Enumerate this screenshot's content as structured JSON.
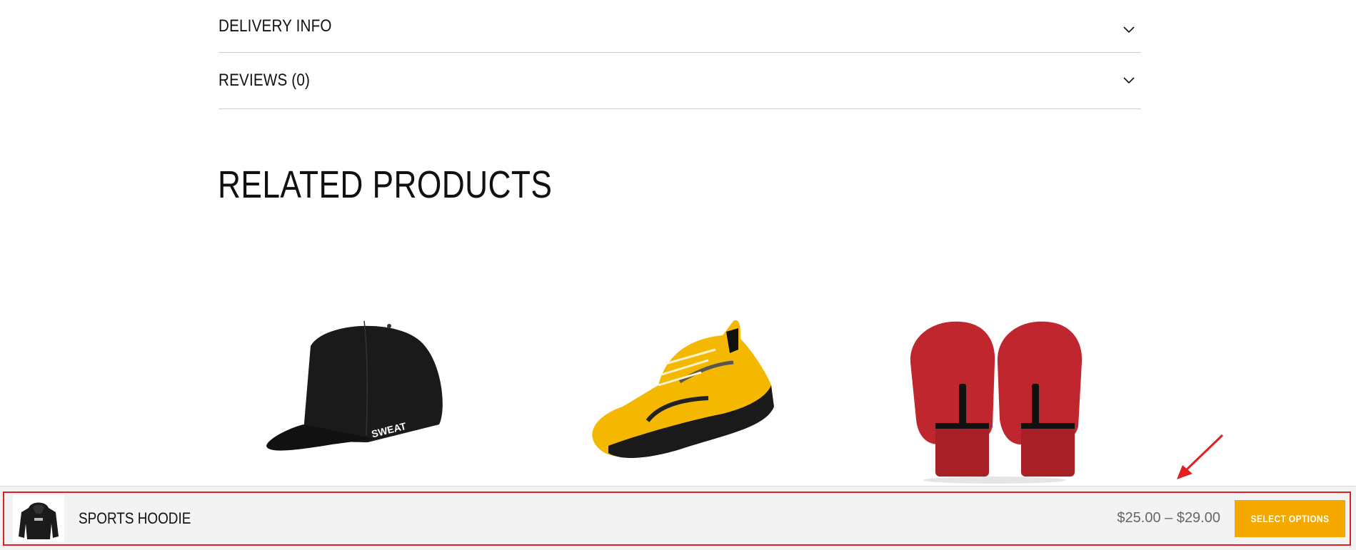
{
  "accordion": {
    "items": [
      {
        "label": "DELIVERY INFO"
      },
      {
        "label": "REVIEWS (0)"
      }
    ]
  },
  "related": {
    "title": "RELATED PRODUCTS",
    "products": [
      {
        "icon": "cap-image",
        "logo_text": "SWEAT"
      },
      {
        "icon": "sneaker-image"
      },
      {
        "icon": "boxing-gloves-image"
      }
    ]
  },
  "sticky_bar": {
    "thumbnail": "hoodie-thumbnail",
    "product_name": "SPORTS HOODIE",
    "price": "$25.00 – $29.00",
    "button_label": "SELECT OPTIONS"
  },
  "colors": {
    "accent": "#f5a800",
    "highlight": "#e02020",
    "bar_bg": "#f3f3f3"
  }
}
